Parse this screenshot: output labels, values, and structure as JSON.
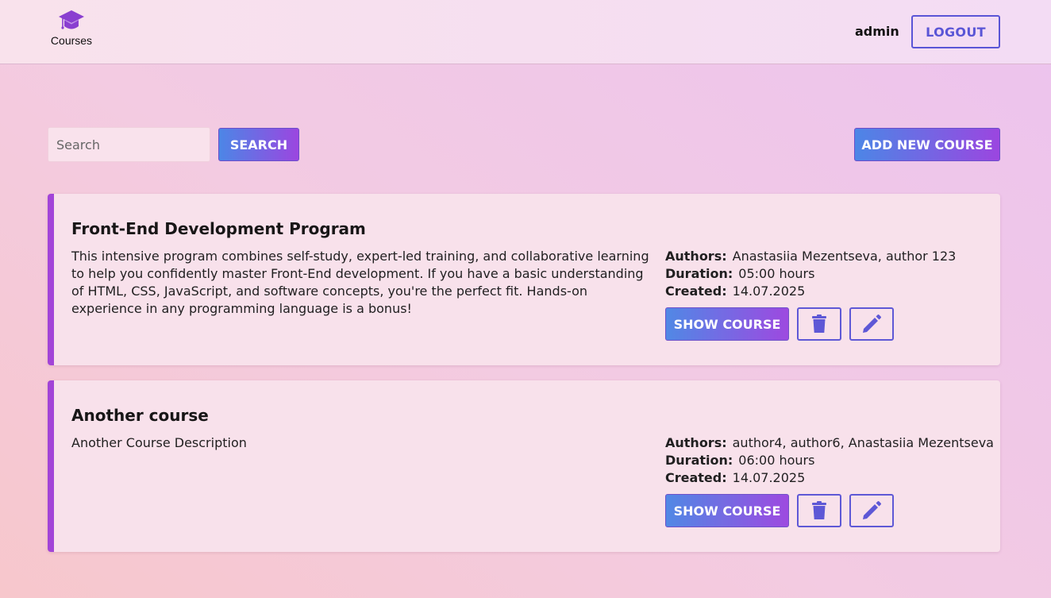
{
  "header": {
    "logo_text": "Courses",
    "username": "admin",
    "logout_label": "LOGOUT"
  },
  "toolbar": {
    "search_placeholder": "Search",
    "search_value": "",
    "search_label": "SEARCH",
    "add_label": "ADD NEW COURSE"
  },
  "labels": {
    "authors": "Authors:",
    "duration": "Duration:",
    "created": "Created:",
    "show_course": "SHOW COURSE"
  },
  "courses": [
    {
      "title": "Front-End Development Program",
      "description": "This intensive program combines self-study, expert-led training, and collaborative learning to help you confidently master Front-End development. If you have a basic understanding of HTML, CSS, JavaScript, and software concepts, you're the perfect fit. Hands-on experience in any programming language is a bonus!",
      "authors": "Anastasiia Mezentseva, author 123",
      "duration": "05:00 hours",
      "created": "14.07.2025"
    },
    {
      "title": "Another course",
      "description": "Another Course Description",
      "authors": "author4, author6, Anastasiia Mezentseva",
      "duration": "06:00 hours",
      "created": "14.07.2025"
    }
  ],
  "colors": {
    "accent": "#5a55d6",
    "card_border": "#a040d8",
    "gradient_start": "#4c86e6",
    "gradient_end": "#9b46e0"
  },
  "icons": {
    "logo": "graduation-cap-icon",
    "delete": "trash-icon",
    "edit": "pencil-icon"
  }
}
